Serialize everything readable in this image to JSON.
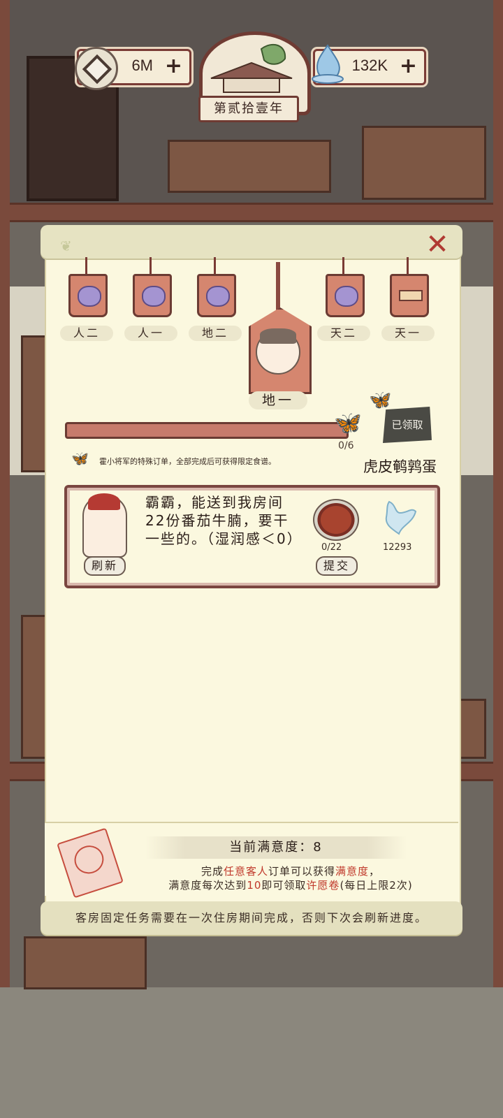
{
  "hud": {
    "coins": "6M",
    "jade": "132K",
    "year_label": "第贰拾壹年",
    "coin_plus": "+",
    "jade_plus": "+"
  },
  "panel": {
    "close_label": "✕",
    "tiers": [
      {
        "label": "人二",
        "icon": "purple-bag-icon"
      },
      {
        "label": "人一",
        "icon": "purple-bag-icon"
      },
      {
        "label": "地二",
        "icon": "purple-bag-icon"
      },
      {
        "label": "天二",
        "icon": "purple-bag-icon"
      },
      {
        "label": "天一",
        "icon": "box-icon"
      }
    ],
    "selected_tier": {
      "label": "地一"
    },
    "progress": {
      "text": "0/6",
      "fraction": 0.0
    },
    "claimed_label": "已领取",
    "reward_name": "虎皮鹌鹑蛋",
    "special_note": "霍小将军的特殊订单，全部完成后可获得限定食谱。"
  },
  "order": {
    "refresh_label": "刷新",
    "text": "霸霸，能送到我房间22份番茄牛腩，要干一些的。（湿润感＜0）",
    "dish_count": "0/22",
    "jade_reward": "12293",
    "submit_label": "提交"
  },
  "satisfaction": {
    "banner": "当前满意度：8",
    "line1_a": "完成",
    "line1_b": "任意客人",
    "line1_c": "订单可以获得",
    "line1_d": "满意度",
    "line1_e": "，",
    "line2_a": "满意度每次达到",
    "line2_b": "10",
    "line2_c": "即可领取",
    "line2_d": "许愿卷",
    "line2_e": "(每日上限2次)"
  },
  "footer": {
    "text": "客房固定任务需要在一次住房期间完成，否则下次会刷新进度。"
  },
  "colors": {
    "accent_red": "#c0392b",
    "panel_bg": "#fbf8df",
    "frame_brown": "#7a4640"
  }
}
